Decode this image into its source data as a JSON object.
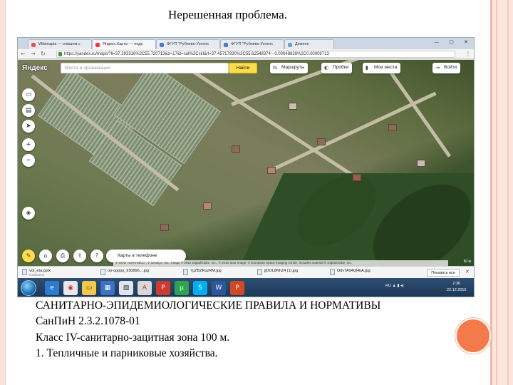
{
  "slide": {
    "title": "Нерешенная проблема.",
    "lines": [
      "САНИТАРНО-ЭПИДЕМИОЛОГИЧЕСКИЕ ПРАВИЛА И НОРМАТИВЫ",
      "СанПиН 2.3.2.1078-01",
      "Класс IV-санитарно-зацитная зона 100 м.",
      "1. Тепличные и парниковые хозяйства."
    ]
  },
  "browser": {
    "tabs": [
      {
        "label": "Wikimapia — опишем с",
        "color": "#d9534f"
      },
      {
        "label": "Яндекс.Карты — подр",
        "color": "#ff3333"
      },
      {
        "label": "ФГУП \"Рублево-Успенс",
        "color": "#4a7cc2"
      },
      {
        "label": "ФГУП \"Рублево-Успенс",
        "color": "#4a7cc2"
      },
      {
        "label": "Доменn",
        "color": "#6aa0d8"
      }
    ],
    "url": "https://yandex.ru/maps/?ll=37.293316%2C55.720713&z=17&l=sat%2Cskl&rl=37.45717830%2C55.62548374~-0.00048828%2C0.00009713",
    "window_controls": "— ▢ ✕"
  },
  "map": {
    "logo": "Яндекс",
    "search_placeholder": "Места и организации",
    "search_button": "Найти",
    "routes_label": "Маршруты",
    "traffic_label": "Пробки",
    "my_places_label": "Мои места",
    "login_label": "Войти",
    "phone_label": "Карты в телефоне",
    "phone_platforms": "  ",
    "copyright": "© ООО «СКАНЭКС», © GeoEye, Inc., Image © 2012 DigitalGlobe, Inc., © 2016 Spot Image, © European Space Imaging GmbH, includes material © DigitalGlobe, Inc.",
    "scale": "50 м"
  },
  "downloads": {
    "items": [
      {
        "name": "vot_eta.pptx",
        "sub": "Отменено"
      },
      {
        "name": "op-opppp_930896....jpg",
        "sub": ""
      },
      {
        "name": "7gZBZRuzRM.jpg",
        "sub": ""
      },
      {
        "name": "jjDOL8NhZ4 (1).jpg",
        "sub": ""
      },
      {
        "name": "OdvTA94QHbA.jpg",
        "sub": ""
      }
    ],
    "show_all": "Показать все"
  },
  "taskbar": {
    "tray_lang": "RU",
    "time": "2:30",
    "date": "22.12.2016"
  }
}
